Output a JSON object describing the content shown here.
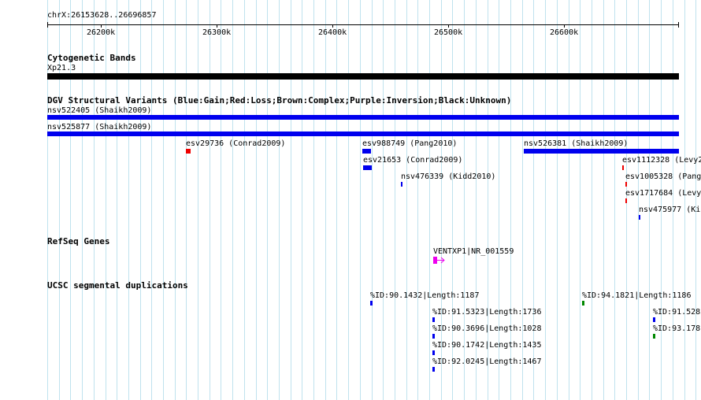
{
  "window": {
    "region_label": "chrX:26153628..26696857"
  },
  "ruler": {
    "ticks": [
      "26200k",
      "26300k",
      "26400k",
      "26500k",
      "26600k"
    ]
  },
  "tracks": {
    "cytoband": {
      "title": "Cytogenetic Bands",
      "band_label": "Xp21.3",
      "color": "#000000"
    },
    "dgv": {
      "title": "DGV Structural Variants (Blue:Gain;Red:Loss;Brown:Complex;Purple:Inversion;Black:Unknown)",
      "features": [
        {
          "label": "nsv522405 (Shaikh2009)",
          "color": "#0000ee"
        },
        {
          "label": "nsv525877 (Shaikh2009)",
          "color": "#0000ee"
        },
        {
          "label": "esv29736 (Conrad2009)",
          "color": "#ee0000"
        },
        {
          "label": "esv988749 (Pang2010)",
          "color": "#0000ee"
        },
        {
          "label": "nsv526381 (Shaikh2009)",
          "color": "#0000ee"
        },
        {
          "label": "esv21653 (Conrad2009)",
          "color": "#0000ee"
        },
        {
          "label": "esv1112328 (Levy2",
          "color": "#ee0000"
        },
        {
          "label": "nsv476339 (Kidd2010)",
          "color": "#0000ee"
        },
        {
          "label": "esv1005328 (Pang",
          "color": "#ee0000"
        },
        {
          "label": "esv1717684 (Levy",
          "color": "#ee0000"
        },
        {
          "label": "nsv475977 (Kic",
          "color": "#0000ee"
        }
      ]
    },
    "refseq": {
      "title": "RefSeq Genes",
      "gene_label": "VENTXP1|NR_001559",
      "color": "#ee00ee"
    },
    "segdup": {
      "title": "UCSC segmental duplications",
      "features": [
        {
          "label": "%ID:90.1432|Length:1187",
          "color": "#0000ee"
        },
        {
          "label": "%ID:94.1821|Length:1186",
          "color": "#008800"
        },
        {
          "label": "%ID:91.5323|Length:1736",
          "color": "#0000ee"
        },
        {
          "label": "%ID:91.5283",
          "color": "#0000ee"
        },
        {
          "label": "%ID:90.3696|Length:1028",
          "color": "#0000ee"
        },
        {
          "label": "%ID:93.178",
          "color": "#008800"
        },
        {
          "label": "%ID:90.1742|Length:1435",
          "color": "#0000ee"
        },
        {
          "label": "%ID:92.0245|Length:1467",
          "color": "#0000ee"
        }
      ]
    }
  },
  "colors": {
    "gridline": "#bfe2ee",
    "gain": "#0000ee",
    "loss": "#ee0000",
    "segdup_green": "#008800"
  }
}
